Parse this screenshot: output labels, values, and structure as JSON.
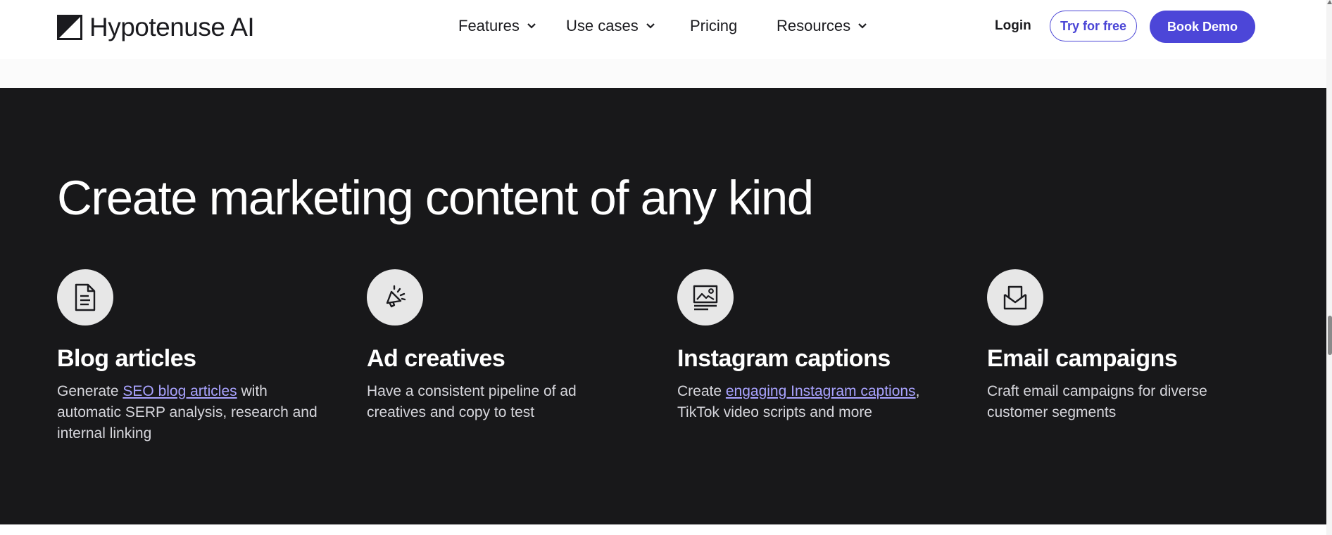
{
  "header": {
    "logo_text": "Hypotenuse AI",
    "nav": [
      {
        "label": "Features",
        "has_dropdown": true
      },
      {
        "label": "Use cases",
        "has_dropdown": true
      },
      {
        "label": "Pricing",
        "has_dropdown": false
      },
      {
        "label": "Resources",
        "has_dropdown": true
      }
    ],
    "login_label": "Login",
    "try_label": "Try for free",
    "demo_label": "Book Demo"
  },
  "section": {
    "headline": "Create marketing content of any kind",
    "cards": [
      {
        "icon": "document-icon",
        "title": "Blog articles",
        "desc_before": "Generate ",
        "link": "SEO blog articles",
        "desc_after": " with automatic SERP analysis, research and internal linking"
      },
      {
        "icon": "megaphone-icon",
        "title": "Ad creatives",
        "desc_before": "Have a consistent pipeline of ad creatives and copy to test",
        "link": "",
        "desc_after": ""
      },
      {
        "icon": "image-caption-icon",
        "title": "Instagram captions",
        "desc_before": "Create ",
        "link": "engaging Instagram captions",
        "desc_after": ", TikTok video scripts and more"
      },
      {
        "icon": "envelope-icon",
        "title": "Email campaigns",
        "desc_before": "Craft email campaigns for diverse customer segments",
        "link": "",
        "desc_after": ""
      }
    ]
  },
  "colors": {
    "accent": "#4c46d8",
    "dark_bg": "#18181a",
    "link": "#a9a3ff",
    "icon_circle": "#e7e7e7"
  }
}
